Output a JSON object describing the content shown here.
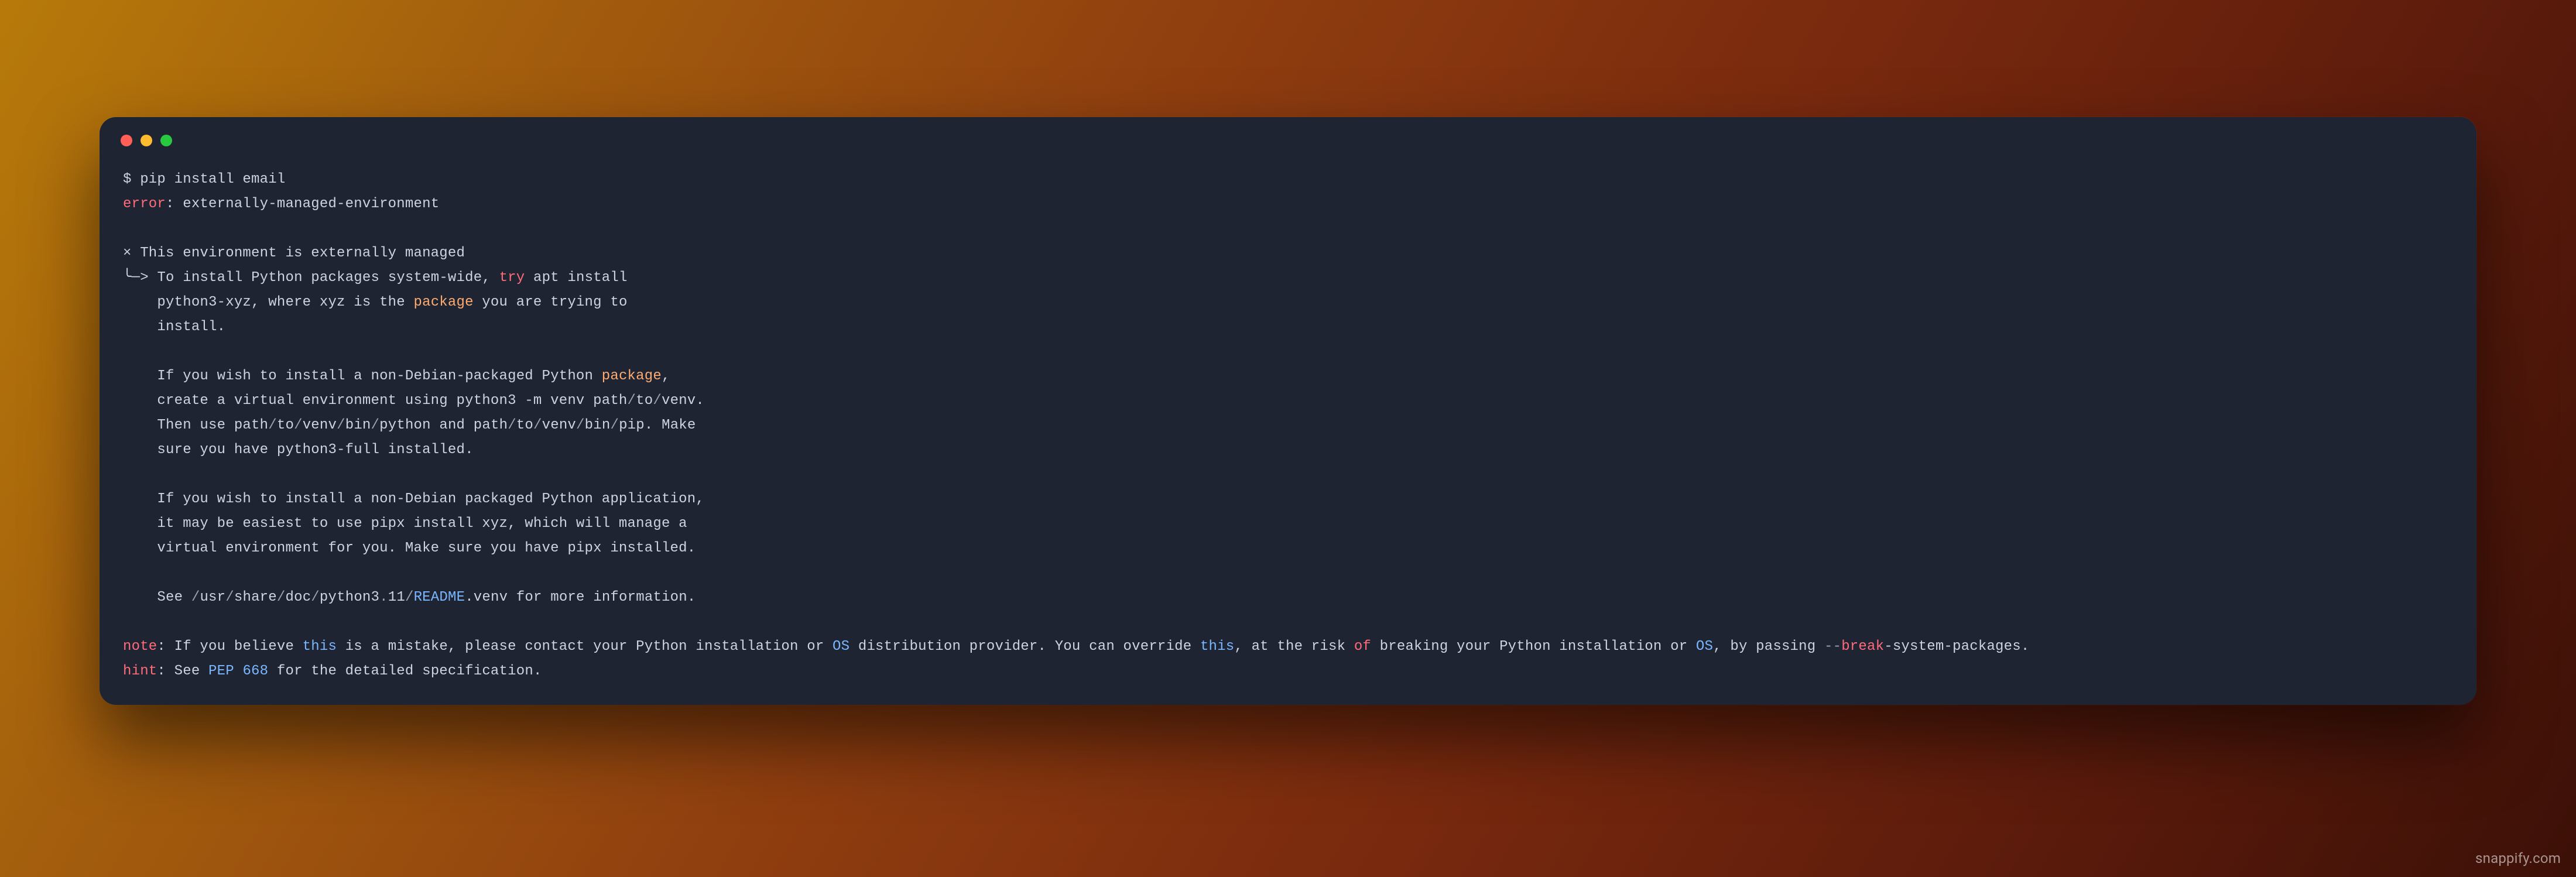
{
  "watermark": "snappify.com",
  "traffic_lights": [
    "close",
    "minimize",
    "zoom"
  ],
  "tokens": [
    [
      [
        "default",
        "$ pip install email"
      ]
    ],
    [
      [
        "red",
        "error"
      ],
      [
        "default",
        ": externally-managed-environment"
      ]
    ],
    [
      [
        "default",
        ""
      ]
    ],
    [
      [
        "default",
        "× This environment is externally managed"
      ]
    ],
    [
      [
        "default",
        "╰─> To install Python packages system-wide, "
      ],
      [
        "red",
        "try"
      ],
      [
        "default",
        " apt install"
      ]
    ],
    [
      [
        "default",
        "    python3-xyz, where xyz is the "
      ],
      [
        "orange",
        "package"
      ],
      [
        "default",
        " you are trying to"
      ]
    ],
    [
      [
        "default",
        "    install."
      ]
    ],
    [
      [
        "default",
        ""
      ]
    ],
    [
      [
        "default",
        "    If you wish to install a non-Debian-packaged Python "
      ],
      [
        "orange",
        "package"
      ],
      [
        "default",
        ","
      ]
    ],
    [
      [
        "default",
        "    create a virtual environment using python3 -m venv path"
      ],
      [
        "gray",
        "/"
      ],
      [
        "default",
        "to"
      ],
      [
        "gray",
        "/"
      ],
      [
        "default",
        "venv."
      ]
    ],
    [
      [
        "default",
        "    Then use path"
      ],
      [
        "gray",
        "/"
      ],
      [
        "default",
        "to"
      ],
      [
        "gray",
        "/"
      ],
      [
        "default",
        "venv"
      ],
      [
        "gray",
        "/"
      ],
      [
        "default",
        "bin"
      ],
      [
        "gray",
        "/"
      ],
      [
        "default",
        "python and path"
      ],
      [
        "gray",
        "/"
      ],
      [
        "default",
        "to"
      ],
      [
        "gray",
        "/"
      ],
      [
        "default",
        "venv"
      ],
      [
        "gray",
        "/"
      ],
      [
        "default",
        "bin"
      ],
      [
        "gray",
        "/"
      ],
      [
        "default",
        "pip. Make"
      ]
    ],
    [
      [
        "default",
        "    sure you have python3-full installed."
      ]
    ],
    [
      [
        "default",
        ""
      ]
    ],
    [
      [
        "default",
        "    If you wish to install a non-Debian packaged Python application,"
      ]
    ],
    [
      [
        "default",
        "    it may be easiest to use pipx install xyz, which will manage a"
      ]
    ],
    [
      [
        "default",
        "    virtual environment for you. Make sure you have pipx installed."
      ]
    ],
    [
      [
        "default",
        ""
      ]
    ],
    [
      [
        "default",
        "    See "
      ],
      [
        "gray",
        "/"
      ],
      [
        "default",
        "usr"
      ],
      [
        "gray",
        "/"
      ],
      [
        "default",
        "share"
      ],
      [
        "gray",
        "/"
      ],
      [
        "default",
        "doc"
      ],
      [
        "gray",
        "/"
      ],
      [
        "default",
        "python3"
      ],
      [
        "gray",
        "."
      ],
      [
        "default",
        "11"
      ],
      [
        "gray",
        "/"
      ],
      [
        "blue",
        "README"
      ],
      [
        "default",
        ".venv for more information."
      ]
    ],
    [
      [
        "default",
        ""
      ]
    ],
    [
      [
        "red",
        "note"
      ],
      [
        "default",
        ": If you believe "
      ],
      [
        "blue",
        "this"
      ],
      [
        "default",
        " is a mistake, please contact your Python installation or "
      ],
      [
        "blue",
        "OS"
      ],
      [
        "default",
        " distribution provider. You can override "
      ],
      [
        "blue",
        "this"
      ],
      [
        "default",
        ", at the risk "
      ],
      [
        "red",
        "of"
      ],
      [
        "default",
        " breaking your Python installation or "
      ],
      [
        "blue",
        "OS"
      ],
      [
        "default",
        ", by passing "
      ],
      [
        "gray",
        "--"
      ],
      [
        "red",
        "break"
      ],
      [
        "default",
        "-system-packages."
      ]
    ],
    [
      [
        "red",
        "hint"
      ],
      [
        "default",
        ": See "
      ],
      [
        "blue",
        "PEP 668"
      ],
      [
        "default",
        " for the detailed specification."
      ]
    ]
  ]
}
